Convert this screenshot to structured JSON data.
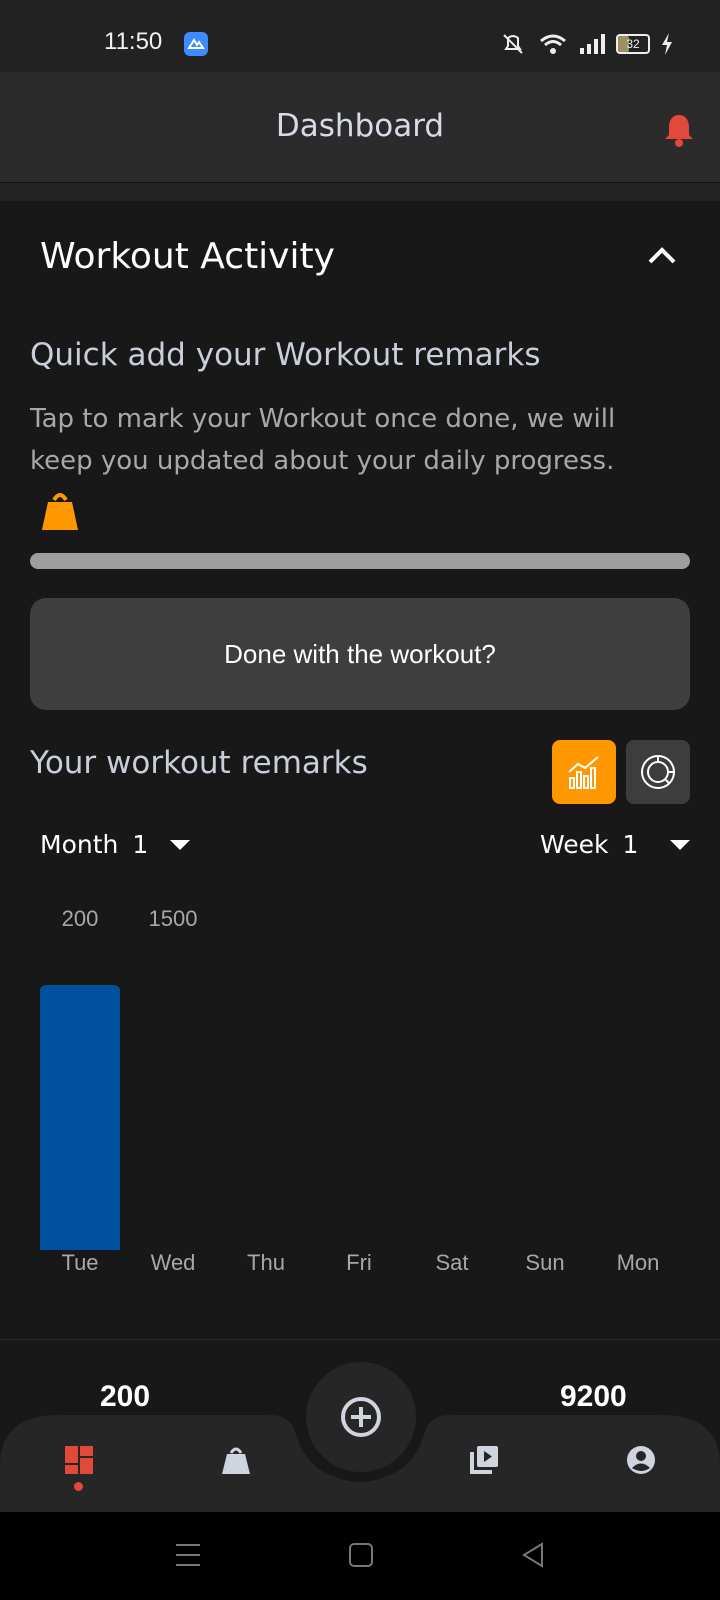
{
  "status_bar": {
    "time": "11:50",
    "battery": "32"
  },
  "app_bar": {
    "title": "Dashboard"
  },
  "workout_activity": {
    "title": "Workout Activity",
    "quick_add_title": "Quick add your Workout remarks",
    "quick_add_description": "Tap to mark your Workout once done, we will keep you updated about your daily progress.",
    "done_button_label": "Done with the workout?"
  },
  "remarks": {
    "title": "Your workout remarks",
    "month_label": "Month",
    "month_value": "1",
    "week_label": "Week",
    "week_value": "1"
  },
  "chart_data": {
    "type": "bar",
    "categories": [
      "Tue",
      "Wed",
      "Thu",
      "Fri",
      "Sat",
      "Sun",
      "Mon"
    ],
    "values": [
      200,
      0,
      0,
      0,
      0,
      0,
      0
    ],
    "value_labels": [
      "200",
      "1500",
      "",
      "",
      "",
      "",
      ""
    ],
    "bar_color": "#0050a0",
    "bar_max": 200,
    "grid": false,
    "title": "",
    "xlabel": "",
    "ylabel": ""
  },
  "totals": {
    "left": "200",
    "right": "9200"
  },
  "colors": {
    "accent": "#ff9800",
    "alert": "#e14a3a",
    "bar": "#0050a0",
    "background": "#181818"
  },
  "nav": {
    "items": [
      {
        "name": "dashboard-icon",
        "active": true
      },
      {
        "name": "weight-icon",
        "active": false
      },
      {
        "name": "add-circle-icon",
        "active": false
      },
      {
        "name": "video-library-icon",
        "active": false
      },
      {
        "name": "account-icon",
        "active": false
      }
    ]
  }
}
